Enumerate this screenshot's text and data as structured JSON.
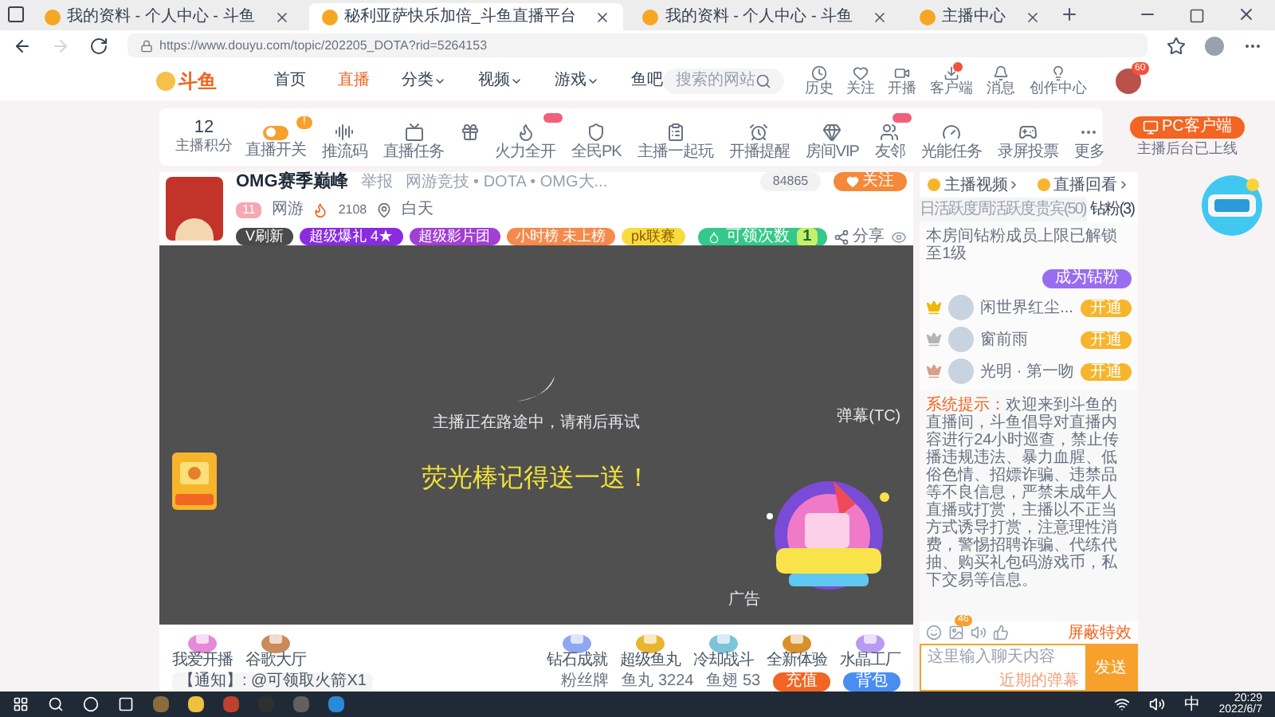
{
  "browser": {
    "tabs": [
      {
        "title": "我的资料 - 个人中心 - 斗鱼",
        "selected": false
      },
      {
        "title": "秘利亚萨快乐加倍_斗鱼直播平台",
        "selected": true
      },
      {
        "title": "我的资料 - 个人中心 - 斗鱼",
        "selected": false
      },
      {
        "title": "主播中心",
        "selected": false
      }
    ],
    "url": "https://www.douyu.com/topic/202205_DOTA?rid=5264153"
  },
  "site_nav": {
    "logo": "斗鱼",
    "items": [
      {
        "label": "首页",
        "selected": false,
        "dropdown": false
      },
      {
        "label": "直播",
        "selected": true,
        "dropdown": false
      },
      {
        "label": "分类",
        "selected": false,
        "dropdown": true
      },
      {
        "label": "视频",
        "selected": false,
        "dropdown": true
      },
      {
        "label": "游戏",
        "selected": false,
        "dropdown": true
      },
      {
        "label": "鱼吧",
        "selected": false,
        "dropdown": false
      }
    ],
    "search": {
      "placeholder": "搜索的网站"
    },
    "actions": [
      {
        "label": "历史",
        "dot": false
      },
      {
        "label": "关注",
        "dot": false
      },
      {
        "label": "开播",
        "dot": false
      },
      {
        "label": "客户端",
        "dot": true
      },
      {
        "label": "消息",
        "dot": false
      },
      {
        "label": "创作中心",
        "dot": false
      }
    ],
    "avatar_badge": "60"
  },
  "toolbar": {
    "score": "12",
    "score_label": "主播积分",
    "items": [
      {
        "label": "直播开关",
        "new": false,
        "badge": "!"
      },
      {
        "label": "推流码",
        "new": false
      },
      {
        "label": "直播任务",
        "new": false
      },
      {
        "new": false
      },
      {
        "label": "火力全开",
        "new": true
      },
      {
        "label": "全民PK",
        "new": false
      },
      {
        "label": "主播一起玩",
        "new": false
      },
      {
        "label": "开播提醒",
        "new": false
      },
      {
        "label": "房间VIP",
        "new": false
      },
      {
        "label": "友邻",
        "new": true
      },
      {
        "label": "光能任务",
        "new": false
      },
      {
        "label": "录屏投票",
        "new": false
      },
      {
        "label": "更多",
        "new": false
      }
    ],
    "pc_button": "PC客户端",
    "pc_note": "主播后台已上线"
  },
  "stream": {
    "title": "OMG赛季巅峰",
    "report": "举报",
    "category": "网游竞技 • DOTA • OMG大...",
    "level": "11",
    "room_type": "网游",
    "heat": "2108",
    "location": "白天",
    "tags": [
      {
        "label": "V刷新",
        "color": "#4a4a4a"
      },
      {
        "label": "超级爆礼 4★",
        "color": "#8a2be2"
      },
      {
        "label": "超级影片团",
        "color": "#a23fd4"
      },
      {
        "label": "小时榜 未上榜",
        "color": "#f58a4b"
      },
      {
        "label": "pk联赛",
        "color": "#f7dc3e"
      }
    ],
    "claim_label": "可领次数",
    "claim_count": "1",
    "share": "分享",
    "followers": "84865",
    "follow": "关注"
  },
  "video": {
    "notice": "主播正在路途中，请稍后再试",
    "slogan": "荧光棒记得送一送！",
    "danmaku": "弹幕(TC)",
    "ad": "广告"
  },
  "gift_bar": {
    "left": [
      {
        "label": "我爱开播",
        "color": "#e58ad8"
      },
      {
        "label": "谷歌大厅",
        "color": "#c98b5a"
      }
    ],
    "right": [
      {
        "label": "钻石成就",
        "color": "#8fa7f0"
      },
      {
        "label": "超级鱼丸",
        "color": "#e8b530"
      },
      {
        "label": "冷却战斗",
        "color": "#7cc4d8"
      },
      {
        "label": "全新体验",
        "color": "#d8902a"
      },
      {
        "label": "水晶工厂",
        "color": "#b89af0"
      }
    ],
    "notice": "【通知】: @可领取火箭X1",
    "fans": "粉丝牌",
    "yuwan": "鱼丸 3224",
    "yuchi": "鱼翅 53",
    "recharge": "充值",
    "bag": "背包"
  },
  "side": {
    "links": [
      "主播视频",
      "直播回看"
    ],
    "tabs": [
      {
        "label": "日活跃度",
        "selected": false
      },
      {
        "label": "周活跃度",
        "selected": false
      },
      {
        "label": "贵宾(50)",
        "selected": false
      },
      {
        "label": "钻粉(3)",
        "selected": true
      }
    ],
    "fan_note": "本房间钻粉成员上限已解锁至1级",
    "become": "成为钻粉",
    "fans": [
      {
        "name": "闲世界红尘...",
        "color": "#f2b705",
        "action": "开通"
      },
      {
        "name": "窗前雨",
        "color": "#b5b5b5",
        "action": "开通"
      },
      {
        "name": "光明 · 第一吻",
        "color": "#d9a08a",
        "action": "开通"
      }
    ],
    "system_label": "系统提示：",
    "system_text": "欢迎来到斗鱼的直播间，斗鱼倡导对直播内容进行24小时巡查，禁止传播违规违法、暴力血腥、低俗色情、招嫖诈骗、违禁品等不良信息，严禁未成年人直播或打赏，主播以不正当方式诱导打赏，注意理性消费，警惕招聘诈骗、代练代抽、购买礼包码游戏币，私下交易等信息。",
    "chat_badge": "46",
    "effects": "屏蔽特效",
    "placeholder": "这里输入聊天内容",
    "recent": "近期的弹幕",
    "send": "发送"
  },
  "taskbar": {
    "ime": "中",
    "time": "20:29",
    "date": "2022/6/7"
  }
}
